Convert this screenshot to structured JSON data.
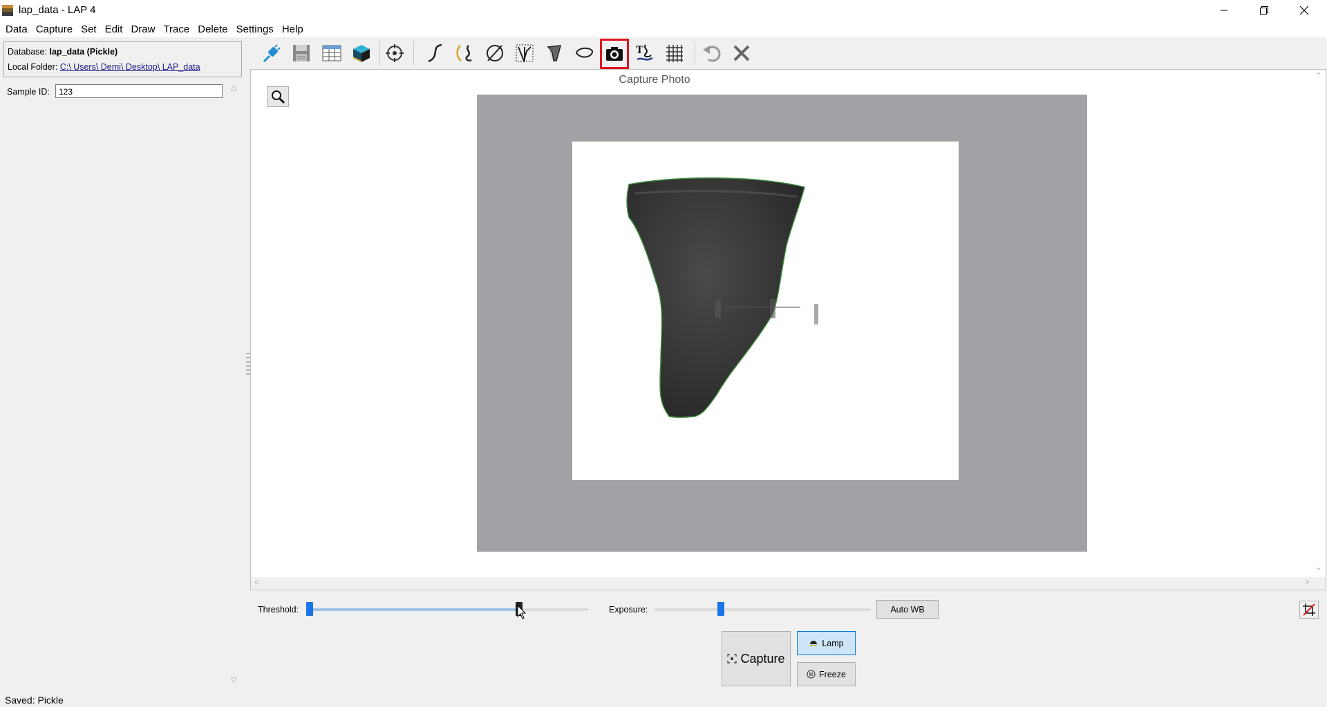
{
  "window": {
    "title": "lap_data - LAP 4",
    "controls": [
      "minimize",
      "restore",
      "close"
    ]
  },
  "menu": [
    "Data",
    "Capture",
    "Set",
    "Edit",
    "Draw",
    "Trace",
    "Delete",
    "Settings",
    "Help"
  ],
  "info": {
    "database_label": "Database:",
    "database_value": "lap_data (Pickle)",
    "folder_label": "Local Folder:",
    "folder_value": "C:\\ Users\\ Demi\\ Desktop\\ LAP_data"
  },
  "sample": {
    "label": "Sample ID:",
    "value": "123"
  },
  "toolbar": {
    "buttons": [
      {
        "icon": "connect-icon"
      },
      {
        "icon": "save-icon"
      },
      {
        "icon": "table-icon"
      },
      {
        "icon": "3d-box-icon"
      },
      {
        "icon": "crosshair-icon"
      },
      {
        "icon": "curve-icon"
      },
      {
        "icon": "spiral-trace-icon"
      },
      {
        "icon": "null-circle-icon"
      },
      {
        "icon": "profile-icon"
      },
      {
        "icon": "sherd-outline-icon"
      },
      {
        "icon": "ellipse-icon"
      },
      {
        "icon": "camera-icon",
        "active": true,
        "active_color": "#e0141e"
      },
      {
        "icon": "text-trace-icon"
      },
      {
        "icon": "grid-icon"
      },
      {
        "icon": "undo-icon"
      },
      {
        "icon": "close-x-icon"
      }
    ]
  },
  "canvas": {
    "title": "Capture Photo",
    "zoom_icon": "magnifier-icon",
    "background_color": "#a2a1a6"
  },
  "controls": {
    "threshold_label": "Threshold:",
    "threshold_value": 0.75,
    "exposure_label": "Exposure:",
    "exposure_value": 0.31,
    "auto_wb_label": "Auto WB",
    "capture_label": "Capture",
    "lamp_label": "Lamp",
    "freeze_label": "Freeze",
    "crop_icon": "crop-off-icon"
  },
  "status": "Saved: Pickle"
}
